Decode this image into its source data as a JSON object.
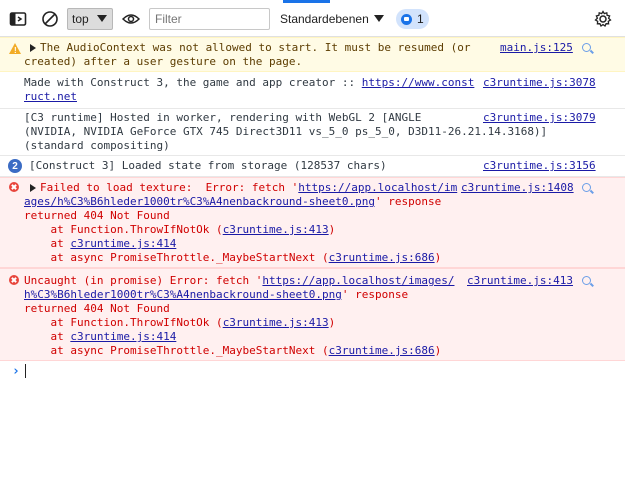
{
  "toolbar": {
    "context": "top",
    "filter_placeholder": "Filter",
    "levels_label": "Standardebenen",
    "message_count": "1"
  },
  "messages": [
    {
      "type": "warning",
      "lines": [
        "The AudioContext was not allowed to start. It must be resumed (or",
        "created) after a user gesture on the page."
      ],
      "source": "main.js:125"
    },
    {
      "type": "log",
      "text": "Made with Construct 3, the game and app creator :: ",
      "url_part1": "https://www.const",
      "url_part2": "ruct.net",
      "source": "c3runtime.js:3078"
    },
    {
      "type": "log",
      "lines": [
        "[C3 runtime] Hosted in worker, rendering with WebGL 2 [ANGLE",
        "(NVIDIA, NVIDIA GeForce GTX 745 Direct3D11 vs_5_0 ps_5_0, D3D11-26.21.14.3168)]",
        "(standard compositing)"
      ],
      "source": "c3runtime.js:3079"
    },
    {
      "type": "log",
      "repeat": "2",
      "text": "[Construct 3] Loaded state from storage (128537 chars)",
      "source": "c3runtime.js:3156"
    },
    {
      "type": "error",
      "text": "Failed to load texture:  Error: fetch '",
      "url_part1": "https://app.localhost/im",
      "url_part2": "ages/h%C3%B6hleder1000tr%C3%A4nenbackround-sheet0.png",
      "after_url": "' response",
      "line3": "returned 404 Not Found",
      "stack": [
        {
          "prefix": "    at Function.ThrowIfNotOk (",
          "link": "c3runtime.js:413",
          "suffix": ")"
        },
        {
          "prefix": "    at ",
          "link": "c3runtime.js:414",
          "suffix": ""
        },
        {
          "prefix": "    at async PromiseThrottle._MaybeStartNext (",
          "link": "c3runtime.js:686",
          "suffix": ")"
        }
      ],
      "source": "c3runtime.js:1408"
    },
    {
      "type": "error",
      "text": "Uncaught (in promise) Error: fetch '",
      "url_part1": "https://app.localhost/images/",
      "url_part2": "h%C3%B6hleder1000tr%C3%A4nenbackround-sheet0.png",
      "after_url": "' response",
      "line3": "returned 404 Not Found",
      "stack": [
        {
          "prefix": "    at Function.ThrowIfNotOk (",
          "link": "c3runtime.js:413",
          "suffix": ")"
        },
        {
          "prefix": "    at ",
          "link": "c3runtime.js:414",
          "suffix": ""
        },
        {
          "prefix": "    at async PromiseThrottle._MaybeStartNext (",
          "link": "c3runtime.js:686",
          "suffix": ")"
        }
      ],
      "source": "c3runtime.js:413"
    }
  ],
  "colors": {
    "accent": "#1a73e8",
    "error_text": "#d00000",
    "warning_bg": "#fffbe5",
    "error_bg": "#fff0f0",
    "link": "#1a1aa6"
  },
  "icons": [
    "sidebar-toggle-icon",
    "clear-console-icon",
    "live-expression-eye-icon",
    "messages-badge-icon",
    "settings-gear-icon",
    "warning-icon",
    "error-icon",
    "expand-triangle-icon",
    "search-magnifier-icon",
    "prompt-chevron-icon"
  ]
}
